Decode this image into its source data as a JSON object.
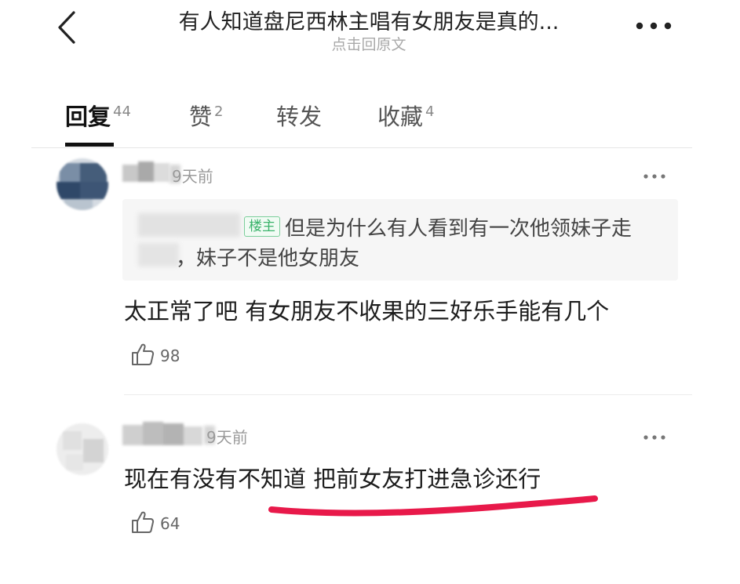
{
  "header": {
    "title": "有人知道盘尼西林主唱有女朋友是真的...",
    "subtitle": "点击回原文",
    "back_icon": "chevron-left-icon",
    "more_icon": "more-horizontal-icon"
  },
  "tabs": [
    {
      "label": "回复",
      "count": "44",
      "active": true
    },
    {
      "label": "赞",
      "count": "2",
      "active": false
    },
    {
      "label": "转发",
      "count": "",
      "active": false
    },
    {
      "label": "收藏",
      "count": "4",
      "active": false
    }
  ],
  "comments": [
    {
      "time": "9天前",
      "quote": {
        "badge": "楼主",
        "line1": "但是为什么有人看到有一次他领妹子走",
        "line2": "，妹子不是他女朋友"
      },
      "text": "太正常了吧 有女朋友不收果的三好乐手能有几个",
      "likes": "98"
    },
    {
      "time": "9天前",
      "text": "现在有没有不知道 把前女友打进急诊还行",
      "likes": "64"
    }
  ],
  "colors": {
    "accent_underline": "#e8194a",
    "op_badge": "#3bb36b",
    "muted": "#9a9a9a"
  }
}
